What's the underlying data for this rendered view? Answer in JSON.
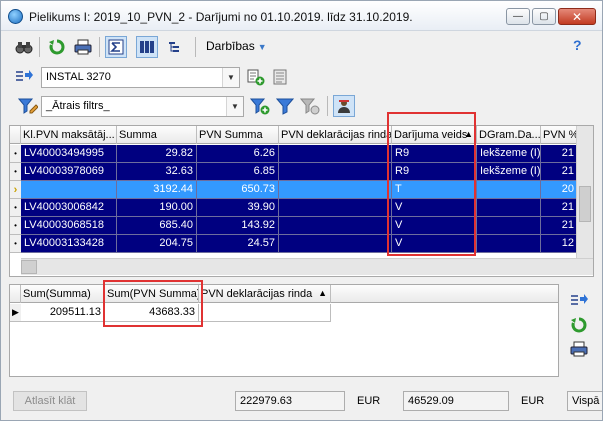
{
  "window": {
    "title": "Pielikums I: 2019_10_PVN_2 - Darījumi no 01.10.2019. līdz 31.10.2019.",
    "minimize": "—",
    "maximize": "▢",
    "close": "✕"
  },
  "toolbar": {
    "actions_label": "Darbības",
    "help_label": "?"
  },
  "selector": {
    "value": "INSTAL 3270"
  },
  "filter": {
    "value": "_Ātrais filtrs_"
  },
  "main_grid": {
    "columns": [
      "Kl.PVN maksātāj...",
      "Summa",
      "PVN Summa",
      "PVN deklarācijas rinda",
      "Darījuma veids",
      "DGram.Da...",
      "PVN %"
    ],
    "sort_marker": "▲",
    "rows": [
      {
        "indicator": "•",
        "kl": "LV40003494995",
        "summa": "29.82",
        "pvn": "6.26",
        "rinda": "",
        "veids": "R9",
        "dgram": "Iekšzeme (I)",
        "pct": "21"
      },
      {
        "indicator": "•",
        "kl": "LV40003978069",
        "summa": "32.63",
        "pvn": "6.85",
        "rinda": "",
        "veids": "R9",
        "dgram": "Iekšzeme (I)",
        "pct": "21"
      },
      {
        "indicator": "›",
        "kl": "",
        "summa": "3192.44",
        "pvn": "650.73",
        "rinda": "",
        "veids": "T",
        "dgram": "",
        "pct": "20"
      },
      {
        "indicator": "•",
        "kl": "LV40003006842",
        "summa": "190.00",
        "pvn": "39.90",
        "rinda": "",
        "veids": "V",
        "dgram": "",
        "pct": "21"
      },
      {
        "indicator": "•",
        "kl": "LV40003068518",
        "summa": "685.40",
        "pvn": "143.92",
        "rinda": "",
        "veids": "V",
        "dgram": "",
        "pct": "21"
      },
      {
        "indicator": "•",
        "kl": "LV40003133428",
        "summa": "204.75",
        "pvn": "24.57",
        "rinda": "",
        "veids": "V",
        "dgram": "",
        "pct": "12"
      }
    ]
  },
  "sum_grid": {
    "columns": [
      "Sum(Summa)",
      "Sum(PVN Summa)",
      "PVN deklarācijas rinda"
    ],
    "sort_marker": "▲",
    "row": {
      "indicator": "▶",
      "sum_summa": "209511.13",
      "sum_pvn": "43683.33",
      "rinda": ""
    }
  },
  "footer": {
    "button": "Atlasīt klāt",
    "total1": "222979.63",
    "unit1": "EUR",
    "total2": "46529.09",
    "unit2": "EUR",
    "option": "Vispā"
  }
}
